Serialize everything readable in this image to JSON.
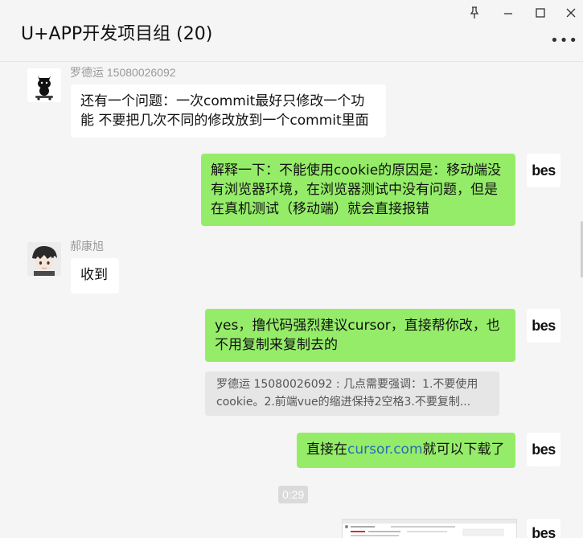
{
  "header": {
    "title": "U+APP开发项目组 (20)",
    "more_label": "•••",
    "controls": {
      "pin_icon": "pin-icon",
      "minimize_icon": "minimize-icon",
      "maximize_icon": "maximize-icon",
      "close_icon": "close-icon"
    }
  },
  "messages": [
    {
      "id": "m1",
      "direction": "in",
      "sender": "罗德运 15080026092",
      "avatar": "cat-skateboard-avatar",
      "text": "还有一个问题：一次commit最好只修改一个功能 不要把几次不同的修改放到一个commit里面"
    },
    {
      "id": "m2",
      "direction": "out",
      "avatar_label": "bes",
      "text": "解释一下：不能使用cookie的原因是：移动端没有浏览器环境，在浏览器测试中没有问题，但是在真机测试（移动端）就会直接报错"
    },
    {
      "id": "m3",
      "direction": "in",
      "sender": "郝康旭",
      "avatar": "anime-boy-avatar",
      "text": "收到"
    },
    {
      "id": "m4",
      "direction": "out",
      "avatar_label": "bes",
      "text": "yes，撸代码强烈建议cursor，直接帮你改，也不用复制来复制去的",
      "quote": "罗德运 15080026092 : 几点需要强调：1.不要使用cookie。2.前端vue的缩进保持2空格3.不要复制..."
    },
    {
      "id": "m5",
      "direction": "out",
      "avatar_label": "bes",
      "text_before": "直接在",
      "link": "cursor.com",
      "text_after": "就可以下载了"
    },
    {
      "id": "m6",
      "direction": "center",
      "timestamp": "0:29"
    },
    {
      "id": "m7",
      "direction": "out",
      "avatar_label": "bes",
      "attachment": "screenshot-thumbnail"
    }
  ],
  "colors": {
    "outgoing_bubble": "#95ec69",
    "incoming_bubble": "#ffffff",
    "background": "#f5f5f5",
    "link": "#2a6cb8"
  }
}
